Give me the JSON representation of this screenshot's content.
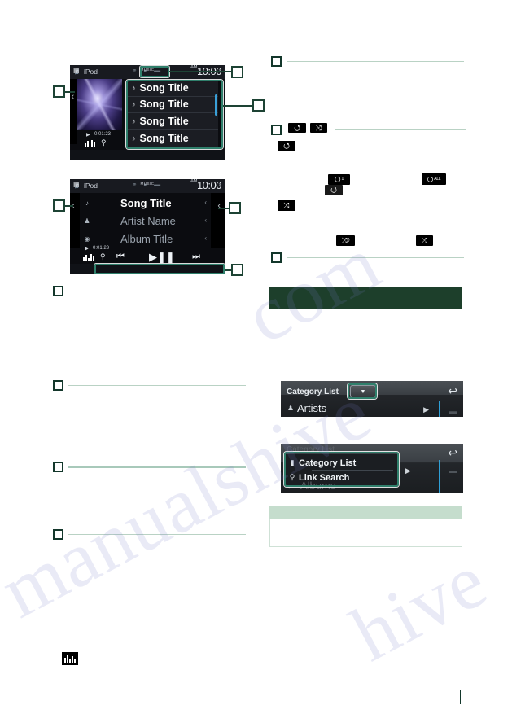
{
  "page": {
    "background": "#ffffff",
    "accent_teal": "#2f7f6b",
    "dark_green": "#1d3f2b",
    "light_green": "#c5ddcd"
  },
  "watermark": {
    "line1": "manualshive",
    "line2": "com",
    "line3": "hive"
  },
  "screen_one": {
    "source_label": "iPod",
    "source_icon": "ipod-icon",
    "clock_time": "10:00",
    "clock_ampm": "AM",
    "status_icons": "⚭ ▸ ▬",
    "elapsed_time": "0:01:23",
    "album_art": "album-artwork",
    "song_list": [
      {
        "title": "Song Title",
        "icon": "music-note-icon"
      },
      {
        "title": "Song Title",
        "icon": "music-note-icon"
      },
      {
        "title": "Song Title",
        "icon": "music-note-icon"
      },
      {
        "title": "Song Title",
        "icon": "music-note-icon"
      }
    ],
    "bottom_source": "MUSIC",
    "left_arrow": "‹",
    "right_arrow": "›"
  },
  "screen_two": {
    "source_label": "iPod",
    "source_icon": "ipod-icon",
    "clock_time": "10:00",
    "clock_ampm": "AM",
    "status_icons": "⚭ ▸ ▬",
    "elapsed_time": "0:01:23",
    "rows": [
      {
        "icon": "music-note-icon",
        "text": "Song Title"
      },
      {
        "icon": "artist-icon",
        "text": "Artist Name"
      },
      {
        "icon": "disc-icon",
        "text": "Album Title"
      }
    ],
    "controls": {
      "previous": "⏮",
      "play_pause": "▶❙❙",
      "next": "⏭",
      "equalizer": "equalizer-icon",
      "search": "search-icon"
    },
    "bottom_source": "MUSIC",
    "left_arrow": "‹",
    "right_arrow": "›"
  },
  "icon_badges": {
    "repeat": "⭯",
    "shuffle": "⤨",
    "repeat_one_sub": "1",
    "repeat_all_sub": "ALL",
    "shuffle_song_sub": ")",
    "equalizer": "equalizer-icon"
  },
  "category_panel": {
    "title": "Category List",
    "dropdown_glyph": "▼",
    "back_glyph": "↩",
    "rows": [
      {
        "icon": "artist-icon",
        "label": "Artists"
      }
    ],
    "ghost_row": "Albums"
  },
  "menu_panel": {
    "title_ghost": "Category List",
    "back_glyph": "↩",
    "items": [
      {
        "icon": "folder-icon",
        "label": "Category List"
      },
      {
        "icon": "search-icon",
        "label": "Link Search"
      }
    ],
    "ghost_row": "Albums",
    "play_glyph": "▶"
  },
  "sections": {
    "left": [
      {
        "number": ""
      },
      {
        "number": ""
      },
      {
        "number": ""
      },
      {
        "number": ""
      }
    ],
    "right": [
      {
        "number": ""
      },
      {
        "number": ""
      },
      {
        "number": ""
      }
    ]
  },
  "callouts": {
    "labels": [
      "",
      "",
      "",
      "",
      "",
      ""
    ]
  }
}
